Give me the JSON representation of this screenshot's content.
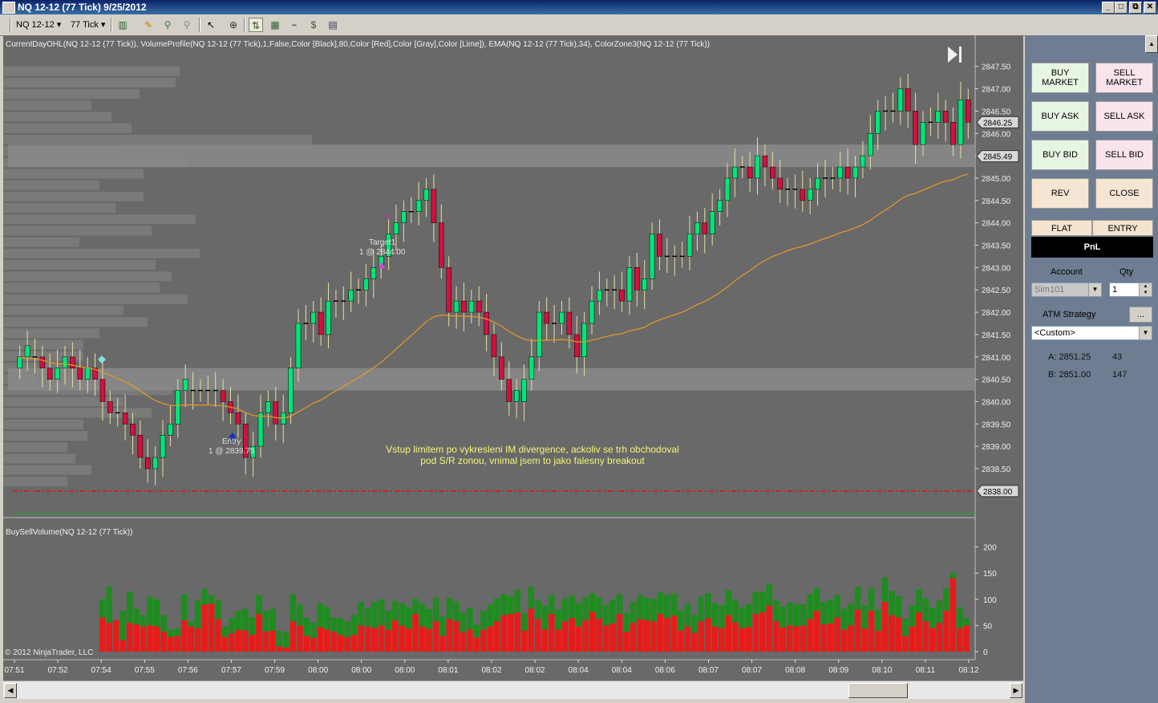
{
  "window": {
    "title": "NQ 12-12 (77 Tick)  9/25/2012",
    "buttons": [
      "_",
      "□",
      "✕",
      "⧉"
    ]
  },
  "toolbar": {
    "instrument": "NQ 12-12",
    "interval": "77 Tick"
  },
  "indicators": {
    "price_panel": "CurrentDayOHL(NQ 12-12 (77 Tick)), VolumeProfile(NQ 12-12 (77 Tick),1,False,Color [Black],80,Color [Red],Color [Gray],Color [Lime]), EMA(NQ 12-12 (77 Tick),34), ColorZone3(NQ 12-12 (77 Tick))",
    "volume_panel": "BuySellVolume(NQ 12-12 (77 Tick))"
  },
  "copyright": "© 2012 NinjaTrader, LLC",
  "annotation": {
    "line1": "Vstup limitem po vykresleni IM divergence, ackoliv se trh obchodoval",
    "line2": "pod S/R zonou, vnimal jsem to jako falesny breakout"
  },
  "markers": {
    "target_label": "Target1",
    "target_detail": "1 @ 2844.00",
    "entry_label": "Entry",
    "entry_detail": "1 @ 2839.75"
  },
  "price_axis": {
    "ticks": [
      "2847.50",
      "2847.00",
      "2846.50",
      "2846.00",
      "2845.50",
      "2845.00",
      "2844.50",
      "2844.00",
      "2843.50",
      "2843.00",
      "2842.50",
      "2842.00",
      "2841.50",
      "2841.00",
      "2840.50",
      "2840.00",
      "2839.50",
      "2839.00",
      "2838.50",
      "2838.00"
    ],
    "last_price": "2846.25",
    "ema_value": "2845.49",
    "dotted_level": "2838.00"
  },
  "volume_axis": {
    "ticks": [
      "200",
      "150",
      "100",
      "50",
      "0"
    ]
  },
  "time_axis": {
    "ticks": [
      "07:51",
      "07:52",
      "07:54",
      "07:55",
      "07:56",
      "07:57",
      "07:59",
      "08:00",
      "08:00",
      "08:00",
      "08:01",
      "08:02",
      "08:02",
      "08:04",
      "08:04",
      "08:06",
      "08:07",
      "08:07",
      "08:08",
      "08:09",
      "08:10",
      "08:11",
      "08:12"
    ]
  },
  "chart_data": {
    "type": "candlestick",
    "y_range": [
      2837.8,
      2847.8
    ],
    "candles": [
      [
        2840.75,
        2841.0
      ],
      [
        2841.0,
        2841.25
      ],
      [
        2841.0,
        2841.0
      ],
      [
        2841.0,
        2840.75
      ],
      [
        2840.75,
        2840.5
      ],
      [
        2840.5,
        2840.75
      ],
      [
        2840.75,
        2841.0
      ],
      [
        2841.0,
        2840.75
      ],
      [
        2840.75,
        2840.5
      ],
      [
        2840.5,
        2840.75
      ],
      [
        2840.75,
        2840.5
      ],
      [
        2840.5,
        2840.0
      ],
      [
        2840.0,
        2839.75
      ],
      [
        2839.75,
        2839.75
      ],
      [
        2839.75,
        2839.5
      ],
      [
        2839.5,
        2839.25
      ],
      [
        2839.25,
        2838.75
      ],
      [
        2838.75,
        2838.5
      ],
      [
        2838.5,
        2838.75
      ],
      [
        2838.75,
        2839.25
      ],
      [
        2839.25,
        2839.5
      ],
      [
        2839.5,
        2840.25
      ],
      [
        2840.25,
        2840.5
      ],
      [
        2840.25,
        2840.25
      ],
      [
        2840.25,
        2840.25
      ],
      [
        2840.25,
        2840.25
      ],
      [
        2840.25,
        2840.25
      ],
      [
        2840.25,
        2840.0
      ],
      [
        2840.0,
        2839.75
      ],
      [
        2839.75,
        2839.5
      ],
      [
        2839.5,
        2838.75
      ],
      [
        2838.75,
        2839.0
      ],
      [
        2839.0,
        2839.75
      ],
      [
        2839.75,
        2840.0
      ],
      [
        2840.0,
        2839.5
      ],
      [
        2839.5,
        2839.75
      ],
      [
        2839.75,
        2840.75
      ],
      [
        2840.75,
        2841.75
      ],
      [
        2841.75,
        2841.75
      ],
      [
        2841.75,
        2842.0
      ],
      [
        2842.0,
        2841.5
      ],
      [
        2841.5,
        2842.25
      ],
      [
        2842.25,
        2842.25
      ],
      [
        2842.25,
        2842.25
      ],
      [
        2842.25,
        2842.5
      ],
      [
        2842.5,
        2842.5
      ],
      [
        2842.5,
        2842.75
      ],
      [
        2842.75,
        2843.0
      ],
      [
        2843.0,
        2843.25
      ],
      [
        2843.25,
        2843.75
      ],
      [
        2843.75,
        2844.0
      ],
      [
        2844.0,
        2844.25
      ],
      [
        2844.25,
        2844.25
      ],
      [
        2844.25,
        2844.5
      ],
      [
        2844.5,
        2844.75
      ],
      [
        2844.75,
        2844.0
      ],
      [
        2844.0,
        2843.0
      ],
      [
        2843.0,
        2842.0
      ],
      [
        2842.0,
        2842.25
      ],
      [
        2842.25,
        2842.0
      ],
      [
        2842.0,
        2842.25
      ],
      [
        2842.25,
        2842.0
      ],
      [
        2842.0,
        2841.5
      ],
      [
        2841.5,
        2841.0
      ],
      [
        2841.0,
        2840.5
      ],
      [
        2840.5,
        2840.0
      ],
      [
        2840.0,
        2840.25
      ],
      [
        2840.0,
        2840.5
      ],
      [
        2840.5,
        2841.0
      ],
      [
        2841.0,
        2842.0
      ],
      [
        2842.0,
        2841.75
      ],
      [
        2841.75,
        2841.75
      ],
      [
        2841.75,
        2842.0
      ],
      [
        2842.0,
        2841.5
      ],
      [
        2841.5,
        2841.0
      ],
      [
        2841.0,
        2841.75
      ],
      [
        2841.75,
        2842.25
      ],
      [
        2842.25,
        2842.5
      ],
      [
        2842.5,
        2842.5
      ],
      [
        2842.5,
        2842.5
      ],
      [
        2842.5,
        2842.25
      ],
      [
        2842.25,
        2843.0
      ],
      [
        2843.0,
        2842.5
      ],
      [
        2842.5,
        2842.75
      ],
      [
        2842.75,
        2843.75
      ],
      [
        2843.75,
        2843.25
      ],
      [
        2843.25,
        2843.25
      ],
      [
        2843.25,
        2843.25
      ],
      [
        2843.25,
        2843.25
      ],
      [
        2843.25,
        2843.75
      ],
      [
        2843.75,
        2844.0
      ],
      [
        2844.0,
        2843.75
      ],
      [
        2843.75,
        2844.25
      ],
      [
        2844.25,
        2844.5
      ],
      [
        2844.5,
        2845.0
      ],
      [
        2845.0,
        2845.25
      ],
      [
        2845.25,
        2845.25
      ],
      [
        2845.25,
        2845.0
      ],
      [
        2845.0,
        2845.5
      ],
      [
        2845.5,
        2845.25
      ],
      [
        2845.25,
        2845.0
      ],
      [
        2845.0,
        2844.75
      ],
      [
        2844.75,
        2844.75
      ],
      [
        2844.75,
        2844.75
      ],
      [
        2844.75,
        2844.5
      ],
      [
        2844.5,
        2844.75
      ],
      [
        2844.75,
        2845.0
      ],
      [
        2845.0,
        2845.0
      ],
      [
        2845.0,
        2845.0
      ],
      [
        2845.0,
        2845.25
      ],
      [
        2845.25,
        2845.0
      ],
      [
        2845.0,
        2845.25
      ],
      [
        2845.25,
        2845.5
      ],
      [
        2845.5,
        2846.0
      ],
      [
        2846.0,
        2846.5
      ],
      [
        2846.5,
        2846.5
      ],
      [
        2846.5,
        2846.5
      ],
      [
        2846.5,
        2847.0
      ],
      [
        2847.0,
        2846.5
      ],
      [
        2846.5,
        2845.75
      ],
      [
        2845.75,
        2846.25
      ],
      [
        2846.25,
        2846.25
      ],
      [
        2846.25,
        2846.5
      ],
      [
        2846.5,
        2846.25
      ],
      [
        2846.25,
        2845.75
      ],
      [
        2845.75,
        2846.75
      ],
      [
        2846.75,
        2846.25
      ]
    ],
    "buy_volume": [
      100,
      125,
      50,
      78,
      115,
      82,
      70,
      105,
      100,
      70,
      42,
      45,
      110,
      58,
      98,
      120,
      108,
      98,
      48,
      65,
      78,
      82,
      66,
      108,
      78,
      82,
      40,
      38,
      110,
      90,
      64,
      56,
      92,
      85,
      65,
      64,
      58,
      70,
      95,
      83,
      95,
      100,
      78,
      97,
      92,
      85,
      101,
      91,
      81,
      102,
      67,
      103,
      96,
      75,
      84,
      51,
      78,
      90,
      102,
      110,
      106,
      118,
      73,
      125,
      99,
      88,
      108,
      80,
      102,
      107,
      92,
      104,
      112,
      104,
      89,
      99,
      110,
      74,
      95,
      108,
      102,
      101,
      113,
      108,
      111,
      78,
      92,
      70,
      105,
      112,
      93,
      89,
      117,
      99,
      85,
      91,
      114,
      115,
      130,
      98,
      86,
      94,
      90,
      91,
      110,
      121,
      95,
      99,
      109,
      82,
      92,
      124,
      87,
      122,
      80,
      142,
      116,
      106,
      63,
      88,
      119,
      102,
      84,
      98,
      121,
      150,
      85,
      64
    ],
    "sell_volume": [
      65,
      55,
      60,
      22,
      55,
      52,
      48,
      50,
      48,
      38,
      28,
      30,
      60,
      48,
      45,
      90,
      92,
      62,
      28,
      35,
      42,
      40,
      32,
      72,
      38,
      40,
      10,
      8,
      58,
      50,
      30,
      26,
      47,
      42,
      38,
      32,
      28,
      32,
      50,
      48,
      45,
      50,
      42,
      60,
      50,
      44,
      72,
      48,
      43,
      58,
      30,
      62,
      58,
      37,
      42,
      27,
      42,
      48,
      58,
      70,
      72,
      75,
      40,
      82,
      62,
      42,
      72,
      42,
      58,
      64,
      48,
      60,
      76,
      63,
      50,
      54,
      72,
      38,
      55,
      62,
      60,
      58,
      72,
      64,
      69,
      40,
      48,
      36,
      58,
      64,
      48,
      45,
      70,
      56,
      45,
      47,
      72,
      75,
      88,
      58,
      46,
      50,
      48,
      50,
      62,
      78,
      52,
      54,
      65,
      42,
      50,
      80,
      44,
      78,
      40,
      95,
      70,
      65,
      30,
      48,
      75,
      58,
      45,
      55,
      78,
      140,
      45,
      50
    ]
  },
  "panel": {
    "buy_market": "BUY MARKET",
    "sell_market": "SELL MARKET",
    "buy_ask": "BUY ASK",
    "sell_ask": "SELL ASK",
    "buy_bid": "BUY BID",
    "sell_bid": "SELL BID",
    "rev": "REV",
    "close": "CLOSE",
    "flat": "FLAT",
    "entry": "ENTRY",
    "pnl": "PnL",
    "account_label": "Account",
    "qty_label": "Qty",
    "account_value": "Sim101",
    "qty_value": "1",
    "atm_label": "ATM Strategy",
    "atm_button": "...",
    "atm_value": "<Custom>",
    "ask_label": "A: 2851.25",
    "ask_size": "43",
    "bid_label": "B: 2851.00",
    "bid_size": "147"
  },
  "colors": {
    "bull": "#00e676",
    "bear": "#d2113c",
    "buy_vol": "#1e8c1e",
    "sell_vol": "#e81b1b",
    "ema": "#e59a2a",
    "background": "#696969",
    "zone": "#888888"
  }
}
